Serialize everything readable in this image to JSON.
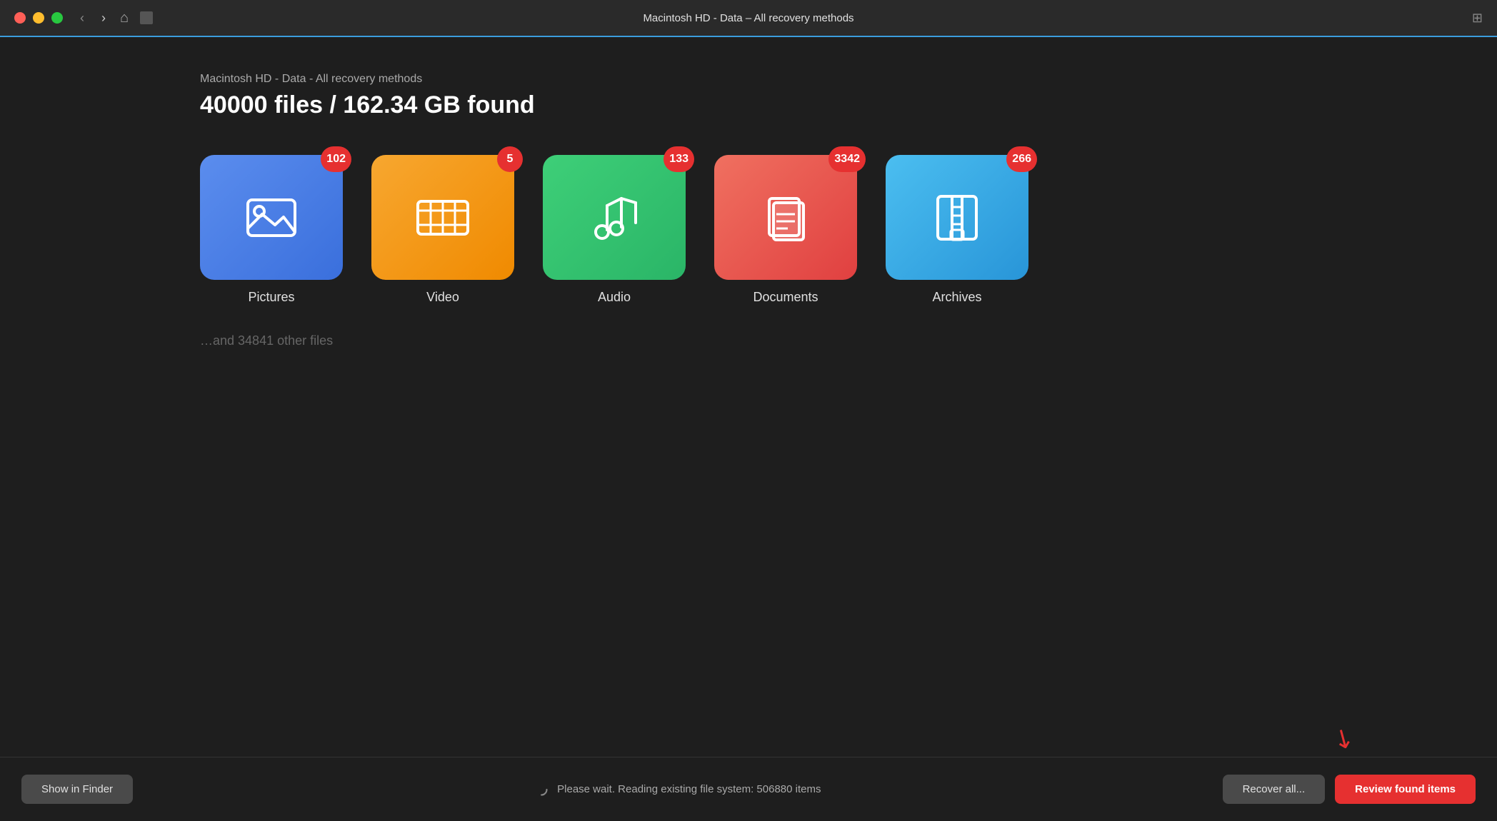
{
  "titleBar": {
    "title": "Macintosh HD - Data – All recovery methods",
    "readerIcon": "⊞"
  },
  "main": {
    "subtitle": "Macintosh HD - Data - All recovery methods",
    "headline": "40000 files / 162.34 GB found",
    "otherFiles": "…and 34841 other files"
  },
  "categories": [
    {
      "id": "pictures",
      "label": "Pictures",
      "badge": "102",
      "colorClass": "card-pictures"
    },
    {
      "id": "video",
      "label": "Video",
      "badge": "5",
      "colorClass": "card-video"
    },
    {
      "id": "audio",
      "label": "Audio",
      "badge": "133",
      "colorClass": "card-audio"
    },
    {
      "id": "documents",
      "label": "Documents",
      "badge": "3342",
      "colorClass": "card-documents"
    },
    {
      "id": "archives",
      "label": "Archives",
      "badge": "266",
      "colorClass": "card-archives"
    }
  ],
  "footer": {
    "showInFinder": "Show in Finder",
    "statusText": "Please wait. Reading existing file system: 506880 items",
    "recoverAll": "Recover all...",
    "reviewFoundItems": "Review found items"
  }
}
